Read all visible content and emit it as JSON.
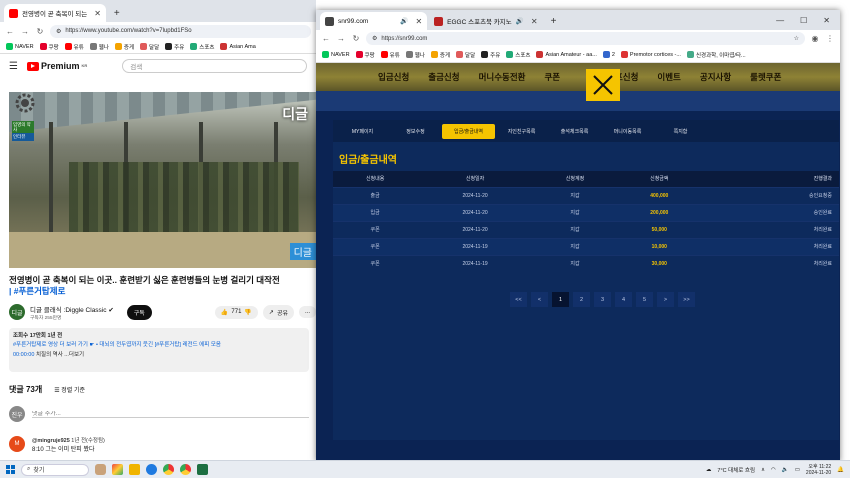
{
  "left_window": {
    "tabs": [
      {
        "title": "전영병이 곧 축복이 되는",
        "active": true
      },
      {
        "title": "",
        "active": false
      }
    ],
    "url": "https://www.youtube.com/watch?v=7lupbd1FSo",
    "bookmarks": [
      "NAVER",
      "쿠팡",
      "유튜",
      "웹나",
      "증게",
      "달달",
      "주유",
      "스포츠",
      "Asian Ama"
    ],
    "logo_text": "Premium",
    "logo_region": "KR",
    "search_placeholder": "검색",
    "video_overlay": {
      "top_right": "디글",
      "badge1": "입영의 약사",
      "badge2": "인터뷰",
      "bottom_right": "디글"
    },
    "video_title": "전영병이 곧 축복이 되는 이곳.. 훈련받기 싫은 훈련병들의 눈병 걸리기 대작전",
    "video_tagline": "| #푸른거탑제로",
    "channel_name": "디글 클래식 :Diggle Classic",
    "channel_subs": "구독자 255만명",
    "channel_avatar": "디글",
    "subscribe_label": "구독",
    "likes": "771",
    "share_label": "공유",
    "more_label": "...",
    "description": {
      "meta": "조회수 17만회 1년 전",
      "line1": "#푸른거탑제로 영상 더 보러 가기 ☛ • 대뇌의 전두엽까지 웃긴 [#푸른거탑] 레전드 에피 모음",
      "timestamp": "00:00:00",
      "line2": "치질의 역사 ...더보기"
    },
    "comments_count": "댓글 73개",
    "sort_label": "정렬 기준",
    "comment_avatar": "진우",
    "comment_placeholder": "댓글 추가...",
    "comment1": {
      "avatar": "M",
      "author": "@mingruje925",
      "time": "1년 전(수정됨)",
      "text": "8:10 그는 이미 탄피 봤다"
    }
  },
  "right_window": {
    "tabs": [
      {
        "title": "snr99.com",
        "active": true
      },
      {
        "title": "EGGC 스포츠북 카지노",
        "active": false
      }
    ],
    "url": "https://snr99.com",
    "bookmarks": [
      "NAVER",
      "쿠팡",
      "유튜",
      "웹나",
      "증게",
      "달달",
      "주유",
      "스포츠",
      "Asian Amateur - aa...",
      "2",
      "Premotor cortices -...",
      "신경과학, 이마엽/타..."
    ],
    "nav_items": [
      "입금신청",
      "출금신청",
      "머니수동전환",
      "쿠폰",
      "콤프신청",
      "이벤트",
      "공지사항",
      "룰렛쿠폰"
    ],
    "sub_tabs": [
      "MY페이지",
      "정보수정",
      "입금/출금내역",
      "지인친구목록",
      "출석체크목록",
      "머니이동목록",
      "쪽지함"
    ],
    "active_sub_tab": 2,
    "section_title": "입금/출금내역",
    "table": {
      "headers": [
        "신청내용",
        "신청일자",
        "신청계정",
        "신청금액",
        "진행결과"
      ],
      "rows": [
        [
          "출금",
          "2024-11-20",
          "지갑",
          "400,000",
          "승인요청중"
        ],
        [
          "입금",
          "2024-11-20",
          "지갑",
          "200,000",
          "승인완료"
        ],
        [
          "쿠폰",
          "2024-11-20",
          "지갑",
          "50,000",
          "처리완료"
        ],
        [
          "쿠폰",
          "2024-11-19",
          "지갑",
          "10,000",
          "처리완료"
        ],
        [
          "쿠폰",
          "2024-11-19",
          "지갑",
          "30,000",
          "처리완료"
        ]
      ]
    },
    "pagination": [
      "<<",
      "<",
      "1",
      "2",
      "3",
      "4",
      "5",
      ">",
      ">>"
    ],
    "active_page": "1"
  },
  "taskbar": {
    "search_label": "찾기",
    "weather": "7°C 대체로 흐림",
    "time": "오후 11:22",
    "date": "2024-11-20"
  },
  "colors": {
    "site_accent": "#f5c400",
    "site_bg": "#0b2353",
    "yt_red": "#ff0000"
  }
}
